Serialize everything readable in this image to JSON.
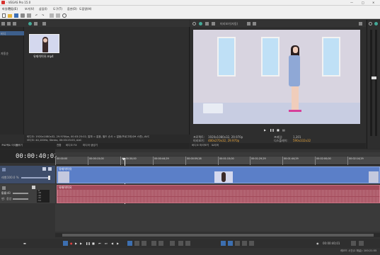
{
  "window": {
    "title": "- VEGAS Pro 15.0"
  },
  "menu": [
    "파일(F)",
    "편집(E)",
    "보기(V)",
    "삽입(I)",
    "도구(T)",
    "옵션(O)",
    "도움말(H)"
  ],
  "explorer": {
    "side_items": [
      "프로젝트 미디어",
      "비디오",
      "오디오",
      "스틸 이미지",
      "자동 분류"
    ],
    "side_labels": [
      "비디",
      "자동순"
    ],
    "media_file": "유재석이유.mp4",
    "media_info_line1": "비디오: 1920x1080x32, 29.970fps, 00:03:25:02, 알파 = 없음, 필드 순서 = 없음(프로그레시브 스캔), AVC",
    "media_info_line2": "오디오: 44,100Hz, Stereo, 00:03:25:03, AAC",
    "tabs": [
      "프로젝트 미디어",
      "탐색기",
      "전환",
      "비디오 FX",
      "미디어 생성기"
    ]
  },
  "preview": {
    "mode_label": "미리보기(자동)",
    "project_label": "프로젝트:",
    "project_value": "1920x1080x32, 29.970p",
    "preview_label": "미리보기:",
    "preview_value": "480x270x32, 29.970p",
    "display_label": "디스플레이:",
    "display_value": "590x332x32",
    "frame_label": "프레임:",
    "frame_value": "1,201",
    "tabs": [
      "비디오 미리보기",
      "트리머"
    ]
  },
  "timeline": {
    "timecode": "00:00:40;01",
    "ruler_marks": [
      "00:00:00",
      "00:00:15;00",
      "00:00:30;00",
      "00:00:44;29",
      "00:00:59;28",
      "00:01:15;00",
      "00:01:29;29",
      "00:01:44;29",
      "00:02:00;00",
      "00:02:14;29"
    ],
    "video_track": {
      "level_label": "레벨:",
      "level_value": "100.0 %",
      "clip_name": "유재석이유"
    },
    "audio_track": {
      "vol_label": "볼륨:",
      "vol_value": "0.0 dB",
      "pan_label": "팬:",
      "pan_value": "중앙",
      "clip_name": "유재석이유"
    },
    "db_ticks": [
      "-6",
      "-18",
      "-30",
      "-42",
      "-54"
    ],
    "end_timecode": "00:00:40;01",
    "status": "레코드 시간(2 채널): 100:21:55"
  },
  "colors": {
    "video_clip": "#5b7fc8",
    "audio_clip": "#a34a5a",
    "timeline_bg": "#3a3a3a",
    "accent": "#4aa3ff"
  }
}
